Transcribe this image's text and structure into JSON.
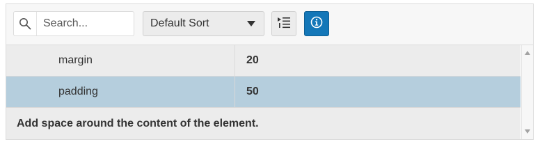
{
  "toolbar": {
    "search": {
      "placeholder": "Search...",
      "value": "",
      "icon": "search-icon"
    },
    "sort": {
      "selected": "Default Sort",
      "icon": "chevron-down-icon"
    },
    "categorize_button": {
      "icon": "categorized-list-icon"
    },
    "info_button": {
      "icon": "info-icon",
      "color": "#1477b8"
    }
  },
  "properties": [
    {
      "name": "margin",
      "value": "20",
      "selected": false
    },
    {
      "name": "padding",
      "value": "50",
      "selected": true
    }
  ],
  "description": "Add space around the content of the element.",
  "colors": {
    "selected_row": "#b5cedd",
    "row_background": "#ececec",
    "accent": "#1477b8"
  }
}
